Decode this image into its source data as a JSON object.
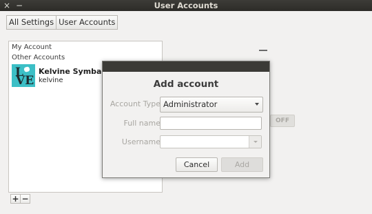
{
  "window": {
    "title": "User Accounts",
    "close_glyph": "×",
    "minimize_glyph": "−"
  },
  "breadcrumbs": [
    "All Settings",
    "User Accounts"
  ],
  "accounts": {
    "my_account_label": "My Account",
    "other_accounts_label": "Other Accounts",
    "items": [
      {
        "name": "Kelvine Symba Xe",
        "username": "kelvine",
        "avatar_text_top": "L",
        "avatar_text_bottom": "VE"
      }
    ],
    "add_glyph": "+",
    "remove_glyph": "−"
  },
  "background_panel": {
    "toggle_label": "OFF"
  },
  "dialog": {
    "heading": "Add account",
    "account_type_label": "Account Type",
    "account_type_value": "Administrator",
    "full_name_label": "Full name",
    "full_name_value": "",
    "username_label": "Username",
    "username_value": "",
    "cancel_label": "Cancel",
    "add_label": "Add"
  }
}
